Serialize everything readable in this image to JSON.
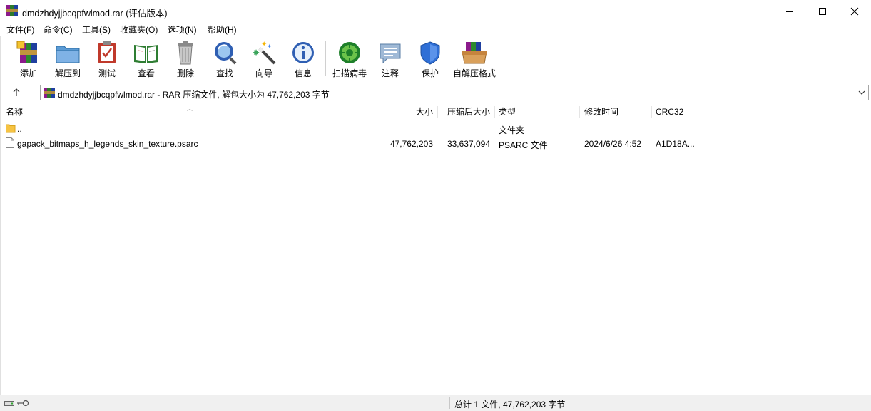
{
  "window": {
    "title": "dmdzhdyjjbcqpfwlmod.rar (评估版本)",
    "minimize_icon": "minimize-icon",
    "maximize_icon": "maximize-icon",
    "close_icon": "close-icon"
  },
  "menu": [
    "文件(F)",
    "命令(C)",
    "工具(S)",
    "收藏夹(O)",
    "选项(N)",
    "帮助(H)"
  ],
  "toolbar": [
    {
      "label": "添加",
      "icon": "add-archive-icon"
    },
    {
      "label": "解压到",
      "icon": "extract-folder-icon"
    },
    {
      "label": "测试",
      "icon": "test-clipboard-icon"
    },
    {
      "label": "查看",
      "icon": "view-book-icon"
    },
    {
      "label": "删除",
      "icon": "trash-icon"
    },
    {
      "label": "查找",
      "icon": "magnifier-icon"
    },
    {
      "label": "向导",
      "icon": "wizard-wand-icon"
    },
    {
      "label": "信息",
      "icon": "info-icon"
    },
    {
      "label": "扫描病毒",
      "icon": "virus-scan-icon"
    },
    {
      "label": "注释",
      "icon": "comment-icon"
    },
    {
      "label": "保护",
      "icon": "shield-icon"
    },
    {
      "label": "自解压格式",
      "icon": "sfx-box-icon"
    }
  ],
  "address": {
    "text": "dmdzhdyjjbcqpfwlmod.rar - RAR 压缩文件, 解包大小为 47,762,203 字节"
  },
  "columns": {
    "name": "名称",
    "size": "大小",
    "packed": "压缩后大小",
    "type": "类型",
    "modified": "修改时间",
    "crc": "CRC32"
  },
  "rows": [
    {
      "name": "..",
      "size": "",
      "packed": "",
      "type": "文件夹",
      "modified": "",
      "crc": "",
      "icon": "folder-icon"
    },
    {
      "name": "gapack_bitmaps_h_legends_skin_texture.psarc",
      "size": "47,762,203",
      "packed": "33,637,094",
      "type": "PSARC 文件",
      "modified": "2024/6/26 4:52",
      "crc": "A1D18A...",
      "icon": "file-icon"
    }
  ],
  "status": {
    "text": "总计 1 文件, 47,762,203 字节"
  },
  "colors": {
    "accent": "#0078d7",
    "statusbar": "#f0f0f0"
  }
}
